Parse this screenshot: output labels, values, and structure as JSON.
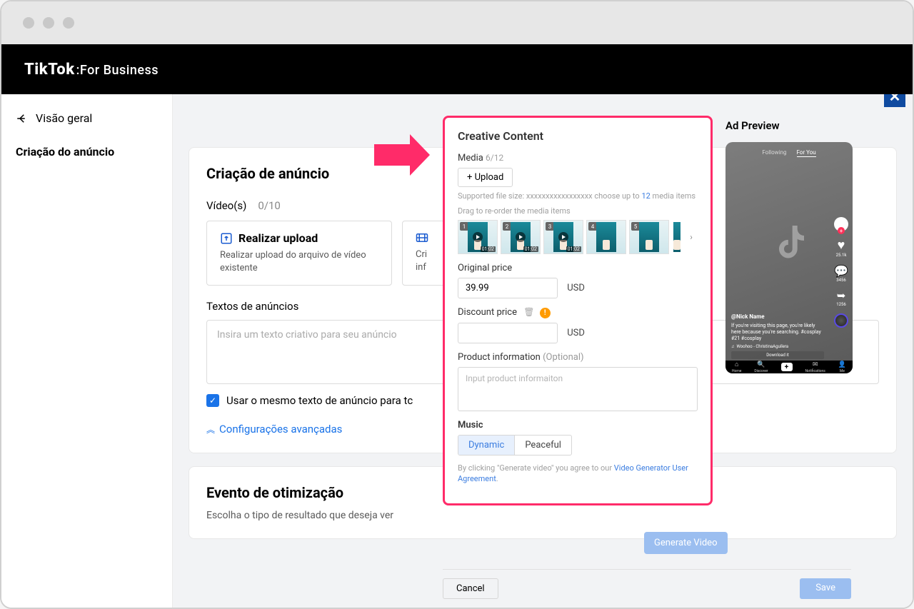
{
  "header": {
    "brand": "TikTok",
    "brand_suffix": ":For Business"
  },
  "sidebar": {
    "back_label": "Visão geral",
    "active_item": "Criação do anúncio"
  },
  "creation": {
    "title": "Criação de anúncio",
    "videos_label": "Vídeo(s)",
    "videos_count": "0/10",
    "upload_card_title": "Realizar upload",
    "upload_card_desc": "Realizar upload do arquivo de vídeo existente",
    "second_card_title_frag": "Cri",
    "second_card_desc_frag": "inf",
    "ad_texts_label": "Textos de anúncios",
    "ad_texts_placeholder": "Insira um texto criativo para seu anúncio",
    "same_text_label": "Usar o mesmo texto de anúncio para tc",
    "advanced_label": "Configurações avançadas"
  },
  "optimization": {
    "title": "Evento de otimização",
    "desc": "Escolha o tipo de resultado que deseja ver"
  },
  "modal": {
    "title": "Creative Content",
    "media_label": "Media",
    "media_count": "6/12",
    "upload_btn": "+ Upload",
    "support_text_pre": "Supported file size: xxxxxxxxxxxxxxxxx choose up to ",
    "support_text_num": "12",
    "support_text_post": " media items",
    "drag_text": "Drag to re-order the media items",
    "thumbs": [
      "01:02",
      "01:02",
      "01:02",
      "",
      ""
    ],
    "orig_price_label": "Original price",
    "orig_price_value": "39.99",
    "disc_price_label": "Discount price",
    "currency": "USD",
    "product_info_label": "Product information",
    "optional_tag": "(Optional)",
    "product_info_ph": "Input product informaiton",
    "music_label": "Music",
    "music_dynamic": "Dynamic",
    "music_peaceful": "Peaceful",
    "agreement_pre": "By clicking \"Generate video\" you agree to our ",
    "agreement_link": "Video Generator User Agreement",
    "generate_btn": "Generate Video",
    "cancel_btn": "Cancel",
    "save_btn": "Save"
  },
  "preview": {
    "title": "Ad Preview",
    "tab_following": "Following",
    "tab_foryou": "For You",
    "likes": "25.1k",
    "comments": "3456",
    "shares": "1256",
    "username": "@Nick Name",
    "caption": "If you're visiting this page, you're likely here because you're searching. #cosplay #21 #cosplay",
    "music": "Woohoo - ChristinaAguilera",
    "download": "Download it",
    "nav_home": "Home",
    "nav_discover": "Discover",
    "nav_notif": "Notifications",
    "nav_me": "Me"
  }
}
